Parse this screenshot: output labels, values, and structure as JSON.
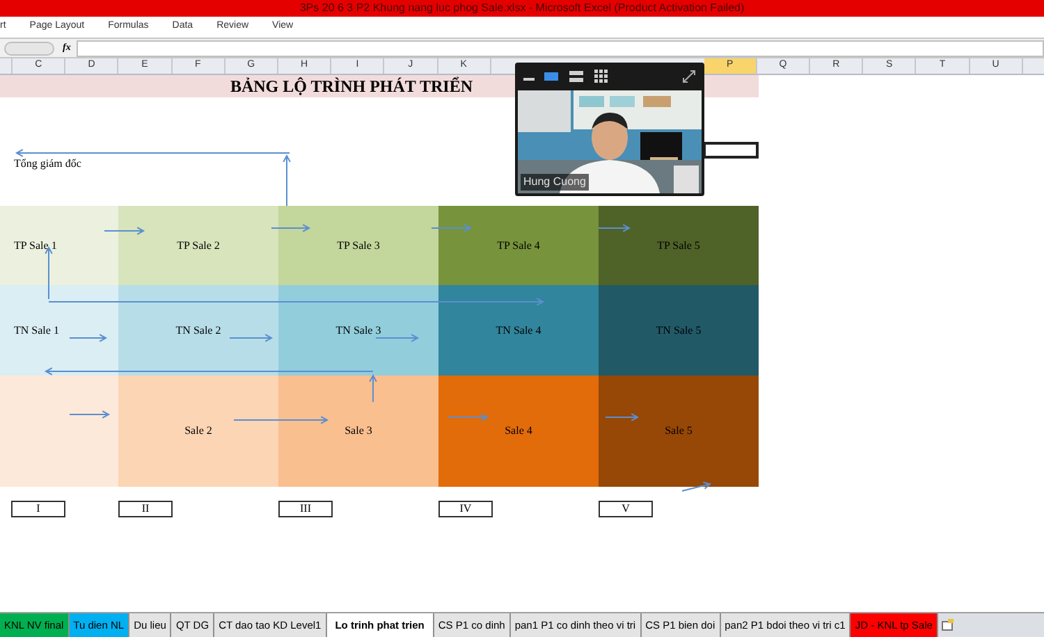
{
  "window": {
    "title": "3Ps 20 6 3 P2 Khung nang luc phog Sale.xlsx  -  Microsoft Excel (Product Activation Failed)"
  },
  "menu": [
    "rt",
    "Page Layout",
    "Formulas",
    "Data",
    "Review",
    "View"
  ],
  "formula_bar": {
    "fx": "fx"
  },
  "columns_left": [
    {
      "label": "C",
      "selected": false
    },
    {
      "label": "D",
      "selected": false
    },
    {
      "label": "E",
      "selected": false
    },
    {
      "label": "F",
      "selected": false
    },
    {
      "label": "G",
      "selected": false
    },
    {
      "label": "H",
      "selected": false
    },
    {
      "label": "I",
      "selected": false
    },
    {
      "label": "J",
      "selected": false
    },
    {
      "label": "K",
      "selected": false
    }
  ],
  "columns_right": [
    {
      "label": "P",
      "selected": true
    },
    {
      "label": "Q",
      "selected": false
    },
    {
      "label": "R",
      "selected": false
    },
    {
      "label": "S",
      "selected": false
    },
    {
      "label": "T",
      "selected": false
    },
    {
      "label": "U",
      "selected": false
    }
  ],
  "diagram": {
    "title": "BẢNG LỘ TRÌNH PHÁT TRIỂN",
    "top_label": "Tổng giám đốc",
    "rows": [
      {
        "cells": [
          {
            "label": "TP Sale 1",
            "color": "#ebf1de"
          },
          {
            "label": "TP Sale 2",
            "color": "#d7e4bc"
          },
          {
            "label": "TP Sale 3",
            "color": "#c3d69b"
          },
          {
            "label": "TP Sale 4",
            "color": "#77933c"
          },
          {
            "label": "TP Sale 5",
            "color": "#4f6228"
          }
        ]
      },
      {
        "cells": [
          {
            "label": "TN Sale 1",
            "color": "#daeef3"
          },
          {
            "label": "TN Sale 2",
            "color": "#b7dee8"
          },
          {
            "label": "TN Sale 3",
            "color": "#92cddc"
          },
          {
            "label": "TN Sale 4",
            "color": "#31859c"
          },
          {
            "label": "TN Sale 5",
            "color": "#215967"
          }
        ]
      },
      {
        "cells": [
          {
            "color": "#fde9d9"
          },
          {
            "label": "Sale 2",
            "color": "#fcd5b4"
          },
          {
            "label": "Sale 3",
            "color": "#fabf8f"
          },
          {
            "label": "Sale 4",
            "color": "#e26b0a"
          },
          {
            "label": "Sale 5",
            "color": "#974706"
          }
        ]
      }
    ],
    "levels": [
      "I",
      "II",
      "III",
      "IV",
      "V"
    ]
  },
  "video": {
    "name": "Hung Cuong",
    "layouts": [
      {
        "kind": "single",
        "selected": true
      },
      {
        "kind": "list",
        "selected": false
      },
      {
        "kind": "grid",
        "selected": false
      }
    ]
  },
  "sheet_tabs": [
    {
      "label": "KNL NV final",
      "color": "#00b050",
      "selected": false
    },
    {
      "label": "Tu dien NL",
      "color": "#00b0f0",
      "selected": false
    },
    {
      "label": "Du lieu",
      "color": "#e4e4e4",
      "selected": false
    },
    {
      "label": "QT DG",
      "color": "#e4e4e4",
      "selected": false
    },
    {
      "label": "CT dao tao KD Level1",
      "color": "#e4e4e4",
      "selected": false
    },
    {
      "label": "Lo trinh phat trien",
      "color": "#ffffff",
      "selected": true
    },
    {
      "label": "CS P1 co dinh",
      "color": "#e4e4e4",
      "selected": false
    },
    {
      "label": "pan1 P1 co dinh theo vi tri",
      "color": "#e4e4e4",
      "selected": false
    },
    {
      "label": "CS P1 bien doi",
      "color": "#e4e4e4",
      "selected": false
    },
    {
      "label": "pan2 P1 bdoi theo vi tri c1",
      "color": "#e4e4e4",
      "selected": false
    },
    {
      "label": "JD - KNL tp Sale",
      "color": "#ff0000",
      "selected": false
    }
  ]
}
